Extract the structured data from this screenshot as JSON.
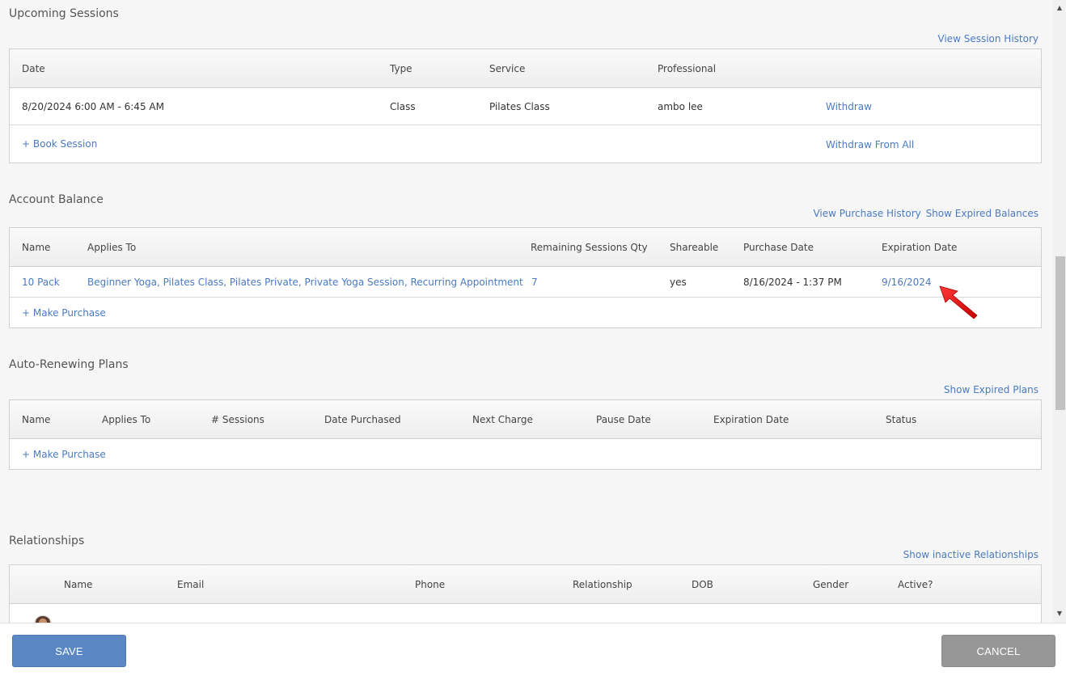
{
  "upcoming": {
    "title": "Upcoming Sessions",
    "history_link": "View Session History",
    "headers": [
      "Date",
      "Type",
      "Service",
      "Professional"
    ],
    "row": {
      "date": "8/20/2024 6:00 AM - 6:45 AM",
      "type": "Class",
      "service": "Pilates Class",
      "professional": "ambo lee",
      "action": "Withdraw"
    },
    "book_link": "+ Book Session",
    "withdraw_all": "Withdraw From All"
  },
  "balance": {
    "title": "Account Balance",
    "purchase_history_link": "View Purchase History",
    "expired_link": "Show Expired Balances",
    "headers": [
      "Name",
      "Applies To",
      "Remaining Sessions Qty",
      "Shareable",
      "Purchase Date",
      "Expiration Date"
    ],
    "row": {
      "name": "10 Pack",
      "applies_to": "Beginner Yoga, Pilates Class, Pilates Private, Private Yoga Session, Recurring Appointment",
      "remaining": "7",
      "shareable": "yes",
      "purchase_date": "8/16/2024 - 1:37 PM",
      "expiration": "9/16/2024"
    },
    "make_purchase": "+ Make Purchase"
  },
  "plans": {
    "title": "Auto-Renewing Plans",
    "expired_link": "Show Expired Plans",
    "headers": [
      "Name",
      "Applies To",
      "# Sessions",
      "Date Purchased",
      "Next Charge",
      "Pause Date",
      "Expiration Date",
      "Status"
    ],
    "make_purchase": "+ Make Purchase"
  },
  "relationships": {
    "title": "Relationships",
    "inactive_link": "Show inactive Relationships",
    "headers": [
      "Name",
      "Email",
      "Phone",
      "Relationship",
      "DOB",
      "Gender",
      "Active?"
    ]
  },
  "footer": {
    "save": "SAVE",
    "cancel": "CANCEL"
  },
  "colors": {
    "link": "#4a7ac0",
    "save": "#5b87c5",
    "cancel": "#979797",
    "arrow": "#e02020"
  }
}
